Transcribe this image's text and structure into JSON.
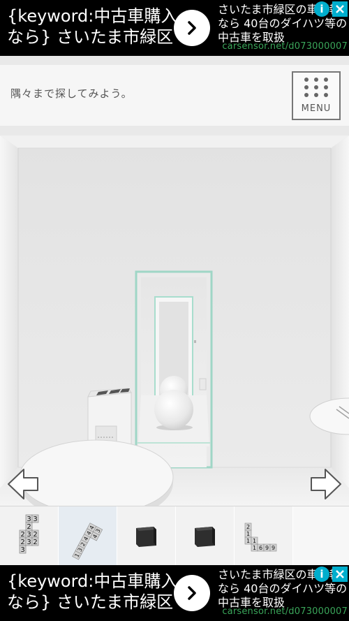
{
  "ad_top": {
    "headline": "{keyword:中古車購入なら} さいたま市緑区",
    "body": "さいたま市緑区の車情報なら 40台のダイハツ等の中古車を取扱",
    "url": "carsensor.net/d073000007",
    "info_icon": "info-icon",
    "close_icon": "close-icon"
  },
  "ad_bottom": {
    "headline": "{keyword:中古車購入なら} さいたま市緑区",
    "body": "さいたま市緑区の車情報なら 40台のダイハツ等の中古車を取扱",
    "url": "carsensor.net/d073000007",
    "info_icon": "info-icon",
    "close_icon": "close-icon"
  },
  "hint": {
    "text": "隅々まで探してみよう。"
  },
  "menu": {
    "label": "MENU",
    "icon": "grid-dots-icon"
  },
  "navigation": {
    "left": "left-arrow-icon",
    "right": "right-arrow-icon"
  },
  "inventory": {
    "items": [
      {
        "name": "number-card-tiles",
        "tiles": [
          "3",
          "3",
          "2",
          "3",
          "2",
          "2",
          "3",
          "2",
          "3"
        ]
      },
      {
        "name": "number-card-diagonal",
        "tiles": [
          "1",
          "3",
          "2",
          "4",
          "4",
          "4",
          "4",
          "3"
        ]
      },
      {
        "name": "black-cube-1"
      },
      {
        "name": "black-cube-2"
      },
      {
        "name": "number-card-l-shape",
        "tiles": [
          "2",
          "1",
          "1",
          "1",
          "1",
          "6",
          "9",
          "9"
        ]
      },
      {
        "name": "empty-slot"
      }
    ]
  },
  "colors": {
    "ad_background": "#000000",
    "ad_url": "#3aa65a",
    "ad_icon": "#00aecd",
    "door_frame": "#9fd6c6"
  }
}
